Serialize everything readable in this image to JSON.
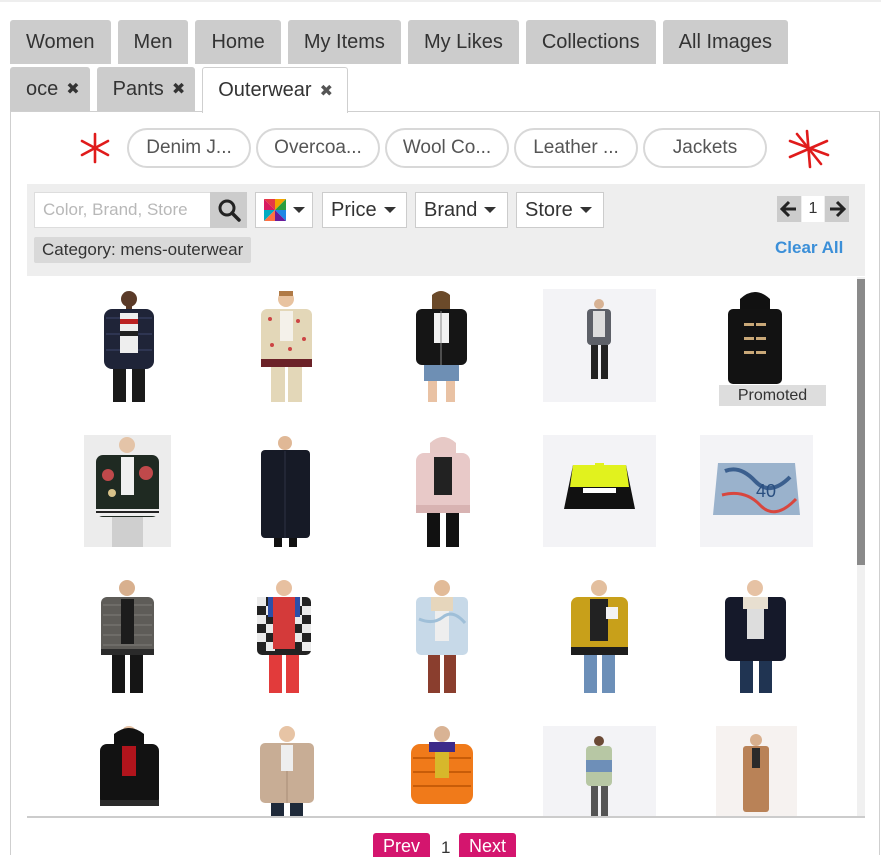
{
  "tabs_row1": [
    {
      "label": "Women"
    },
    {
      "label": "Men"
    },
    {
      "label": "Home"
    },
    {
      "label": "My Items"
    },
    {
      "label": "My Likes"
    },
    {
      "label": "Collections"
    },
    {
      "label": "All Images"
    }
  ],
  "tabs_row2": [
    {
      "label": "oce",
      "close": "✖"
    },
    {
      "label": "Pants",
      "close": "✖"
    },
    {
      "label": "Outerwear",
      "close": "✖",
      "active": true
    }
  ],
  "subcategories": [
    "Denim J...",
    "Overcoa...",
    "Wool Co...",
    "Leather ...",
    "Jackets"
  ],
  "search": {
    "placeholder": "Color, Brand, Store",
    "value": ""
  },
  "filters": {
    "price": "Price",
    "brand": "Brand",
    "store": "Store"
  },
  "pager_top": {
    "page": "1"
  },
  "active_filter": "Category: mens-outerwear",
  "clear_all": "Clear All",
  "badges": {
    "promoted": "Promoted"
  },
  "pager_bottom": {
    "prev": "Prev",
    "page": "1",
    "next": "Next"
  },
  "colors": {
    "accent_pink": "#d4156e",
    "link_blue": "#3b8fd8",
    "tab_gray": "#cccccc",
    "star_red": "#e01b1b"
  },
  "products": [
    {
      "name": "navy puffer jacket"
    },
    {
      "name": "printed bomber jacket"
    },
    {
      "name": "black leather biker jacket"
    },
    {
      "name": "grey denim jacket"
    },
    {
      "name": "black duffle coat",
      "promoted": true
    },
    {
      "name": "satin souvenir jacket"
    },
    {
      "name": "black overcoat"
    },
    {
      "name": "pink bomber jacket"
    },
    {
      "name": "neon colorblock windbreaker"
    },
    {
      "name": "graffiti denim jacket"
    },
    {
      "name": "tweed bomber jacket"
    },
    {
      "name": "plaid shirt jacket"
    },
    {
      "name": "light wash denim jacket"
    },
    {
      "name": "gold satin bomber"
    },
    {
      "name": "dark denim jacket"
    },
    {
      "name": "black satin bomber"
    },
    {
      "name": "tan harrington jacket"
    },
    {
      "name": "orange puffer jacket"
    },
    {
      "name": "colorblock rain jacket"
    },
    {
      "name": "camel overcoat"
    }
  ]
}
